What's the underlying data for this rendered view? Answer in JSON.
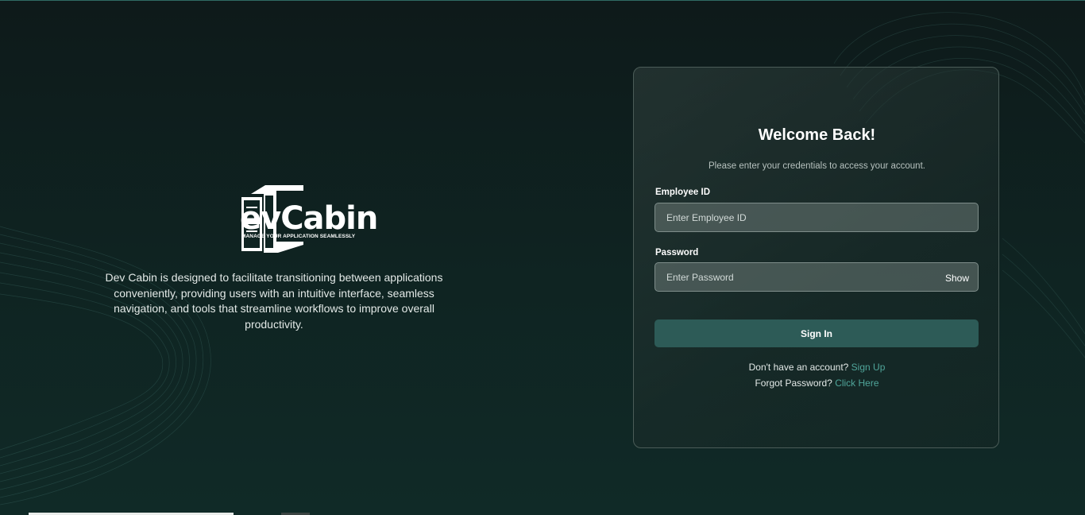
{
  "colors": {
    "accent": "#2d5b57",
    "link": "#4fa59a",
    "background": "#0f2422"
  },
  "brand": {
    "logo_word": "evCabin",
    "logo_tagline": "MANAGE YOUR APPLICATION SEAMLESSLY",
    "description": "Dev Cabin is designed to facilitate transitioning between applications conveniently, providing users with an intuitive interface, seamless navigation, and tools that streamline workflows to improve overall productivity."
  },
  "login": {
    "title": "Welcome Back!",
    "subtitle": "Please enter your credentials to access your account.",
    "employee_id": {
      "label": "Employee ID",
      "placeholder": "Enter Employee ID",
      "value": ""
    },
    "password": {
      "label": "Password",
      "placeholder": "Enter Password",
      "value": "",
      "toggle": "Show"
    },
    "sign_in": "Sign In",
    "signup_prompt": "Don't have an account?",
    "signup_link": "Sign Up",
    "forgot_prompt": "Forgot Password?",
    "forgot_link": "Click Here"
  }
}
